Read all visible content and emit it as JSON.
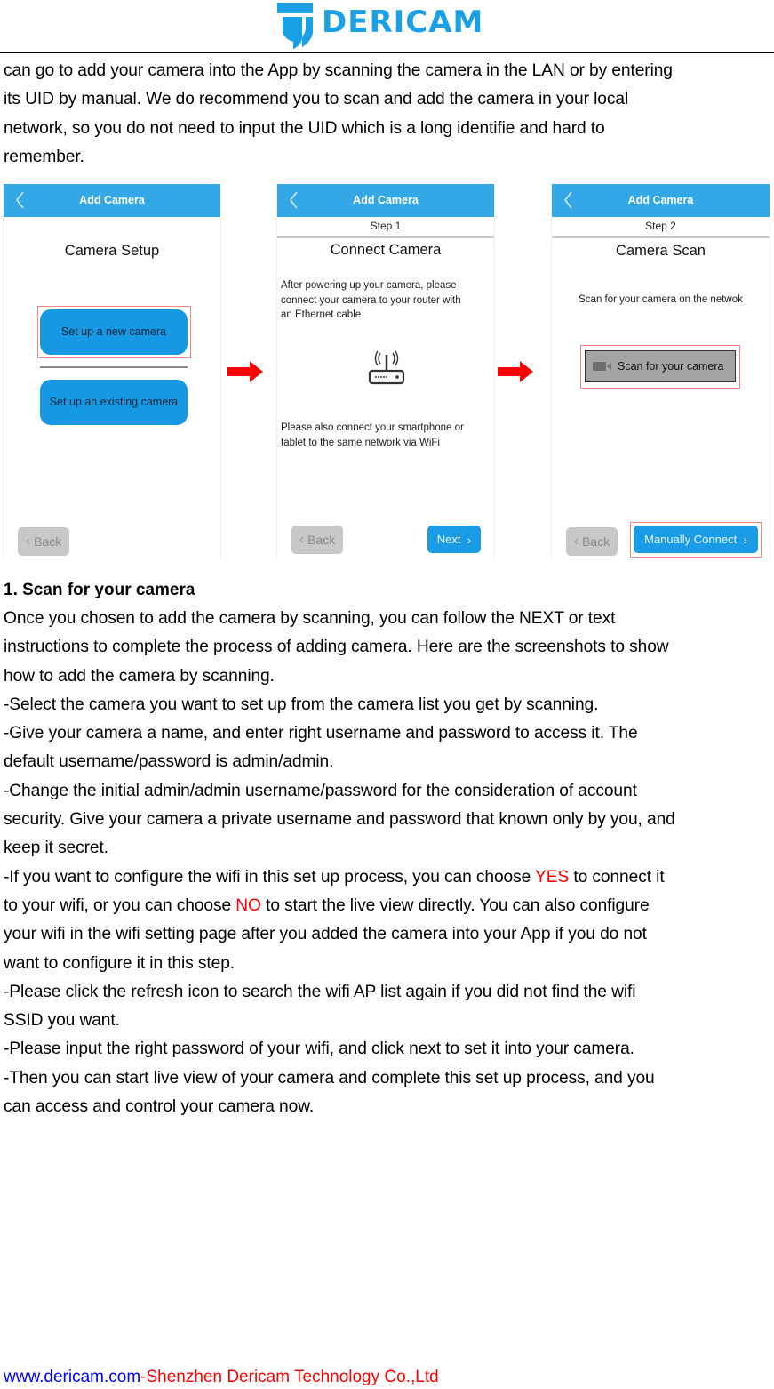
{
  "header": {
    "brand": "DERICAM",
    "brand_color": "#1aa0e6"
  },
  "intro": {
    "lines": [
      "can go to add your camera into the App by scanning the camera in the LAN or by entering",
      "its UID by manual. We do recommend you to scan and add the camera in your local",
      "network, so you do not need to input the UID which is a long identifie and hard to",
      "remember."
    ]
  },
  "screens": [
    {
      "nav_title": "Add Camera",
      "title": "Camera Setup",
      "buttons": [
        "Set up a new camera",
        "Set up an existing camera"
      ],
      "back_label": "Back"
    },
    {
      "nav_title": "Add Camera",
      "step": "Step 1",
      "title": "Connect Camera",
      "desc_top": [
        "After powering up your camera, please",
        "connect your camera to your router with",
        "an Ethernet cable"
      ],
      "desc_bottom": [
        "Please also connect your smartphone or",
        "tablet to the same network via WiFi"
      ],
      "back_label": "Back",
      "next_label": "Next"
    },
    {
      "nav_title": "Add Camera",
      "step": "Step 2",
      "title": "Camera Scan",
      "desc": "Scan for your camera on the netwok",
      "scan_label": "Scan for your camera",
      "back_label": "Back",
      "manual_label": "Manually Connect"
    }
  ],
  "section": {
    "title": "1. Scan for your camera",
    "lines": [
      {
        "parts": [
          {
            "t": "Once you chosen to add the camera by scanning, you can follow the NEXT or text"
          }
        ]
      },
      {
        "parts": [
          {
            "t": "instructions to complete the process of adding camera. Here are the screenshots to show"
          }
        ]
      },
      {
        "parts": [
          {
            "t": "how to add the camera by scanning."
          }
        ]
      },
      {
        "parts": [
          {
            "t": "-Select the camera you want to set up from the camera list you get by scanning."
          }
        ]
      },
      {
        "parts": [
          {
            "t": "-Give your camera a name, and enter right username and password to access it. The"
          }
        ]
      },
      {
        "parts": [
          {
            "t": "default username/password is admin/admin."
          }
        ]
      },
      {
        "parts": [
          {
            "t": "-Change the initial admin/admin username/password for the consideration of account"
          }
        ]
      },
      {
        "parts": [
          {
            "t": "security. Give your camera a private username and password that known only by you, and"
          }
        ]
      },
      {
        "parts": [
          {
            "t": "keep it secret."
          }
        ]
      },
      {
        "parts": [
          {
            "t": "-If you want to configure the wifi in this set up process, you can choose "
          },
          {
            "t": "YES",
            "red": true
          },
          {
            "t": " to connect it"
          }
        ]
      },
      {
        "parts": [
          {
            "t": "to your wifi, or you can choose "
          },
          {
            "t": "NO",
            "red": true
          },
          {
            "t": " to start the live view directly. You can also configure"
          }
        ]
      },
      {
        "parts": [
          {
            "t": "your wifi in the wifi setting page after you added the camera into your App if you do not"
          }
        ]
      },
      {
        "parts": [
          {
            "t": "want to configure it in this step."
          }
        ]
      },
      {
        "parts": [
          {
            "t": "-Please click the refresh icon to search the wifi AP list again if you did not find the wifi"
          }
        ]
      },
      {
        "parts": [
          {
            "t": "SSID you want."
          }
        ]
      },
      {
        "parts": [
          {
            "t": "-Please input the right password of your wifi, and click next to set it into your camera."
          }
        ]
      },
      {
        "parts": [
          {
            "t": "-Then you can start live view of your camera and complete this set up process, and you"
          }
        ]
      },
      {
        "parts": [
          {
            "t": "can access and control your camera now."
          }
        ]
      }
    ]
  },
  "footer": {
    "website": "www.dericam.com",
    "separator": "-",
    "company": "Shenzhen Dericam Technology Co.,Ltd"
  }
}
